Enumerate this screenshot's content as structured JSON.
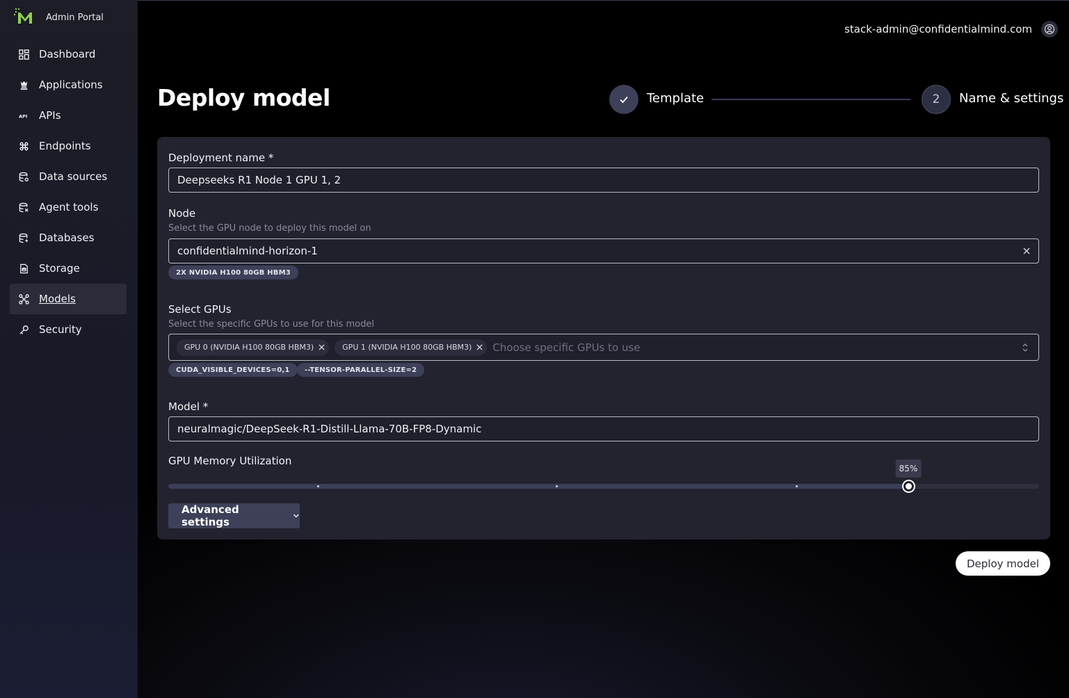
{
  "app": {
    "title": "Admin Portal",
    "logo_icon": "confidentialmind-logo"
  },
  "sidebar": {
    "items": [
      {
        "label": "Dashboard",
        "icon": "grid-icon",
        "active": false
      },
      {
        "label": "Applications",
        "icon": "chess-icon",
        "active": false
      },
      {
        "label": "APIs",
        "icon": "api-icon",
        "active": false
      },
      {
        "label": "Endpoints",
        "icon": "command-icon",
        "active": false
      },
      {
        "label": "Data sources",
        "icon": "database-gear-icon",
        "active": false
      },
      {
        "label": "Agent tools",
        "icon": "database-tool-icon",
        "active": false
      },
      {
        "label": "Databases",
        "icon": "database-icon",
        "active": false
      },
      {
        "label": "Storage",
        "icon": "file-icon",
        "active": false
      },
      {
        "label": "Models",
        "icon": "models-icon",
        "active": true
      },
      {
        "label": "Security",
        "icon": "key-icon",
        "active": false
      }
    ]
  },
  "header": {
    "user_email": "stack-admin@confidentialmind.com",
    "user_icon": "user-circle-icon"
  },
  "page": {
    "title": "Deploy model"
  },
  "stepper": {
    "steps": [
      {
        "label": "Template",
        "state": "done",
        "icon": "check-icon"
      },
      {
        "number": "2",
        "label": "Name & settings",
        "state": "current"
      }
    ]
  },
  "form": {
    "deployment_name": {
      "label": "Deployment name *",
      "value": "Deepseeks R1 Node 1 GPU 1, 2"
    },
    "node": {
      "label": "Node",
      "help": "Select the GPU node to deploy this model on",
      "value": "confidentialmind-horizon-1",
      "badge": "2X NVIDIA H100 80GB HBM3"
    },
    "gpus": {
      "label": "Select GPUs",
      "help": "Select the specific GPUs to use for this model",
      "selected": [
        "GPU 0 (NVIDIA H100 80GB HBM3)",
        "GPU 1 (NVIDIA H100 80GB HBM3)"
      ],
      "placeholder": "Choose specific GPUs to use",
      "badges": [
        "CUDA_VISIBLE_DEVICES=0,1",
        "--TENSOR-PARALLEL-SIZE=2"
      ]
    },
    "model": {
      "label": "Model *",
      "value": "neuralmagic/DeepSeek-R1-Distill-Llama-70B-FP8-Dynamic"
    },
    "gpu_memory": {
      "label": "GPU Memory Utilization",
      "value_label": "85%",
      "value": 0.85,
      "marks": [
        0.172,
        0.446,
        0.721
      ]
    },
    "advanced_label": "Advanced settings"
  },
  "actions": {
    "deploy_label": "Deploy model"
  },
  "colors": {
    "accent": "#3d4058",
    "logo_green": "#8fd14f",
    "card": "#22232f"
  }
}
